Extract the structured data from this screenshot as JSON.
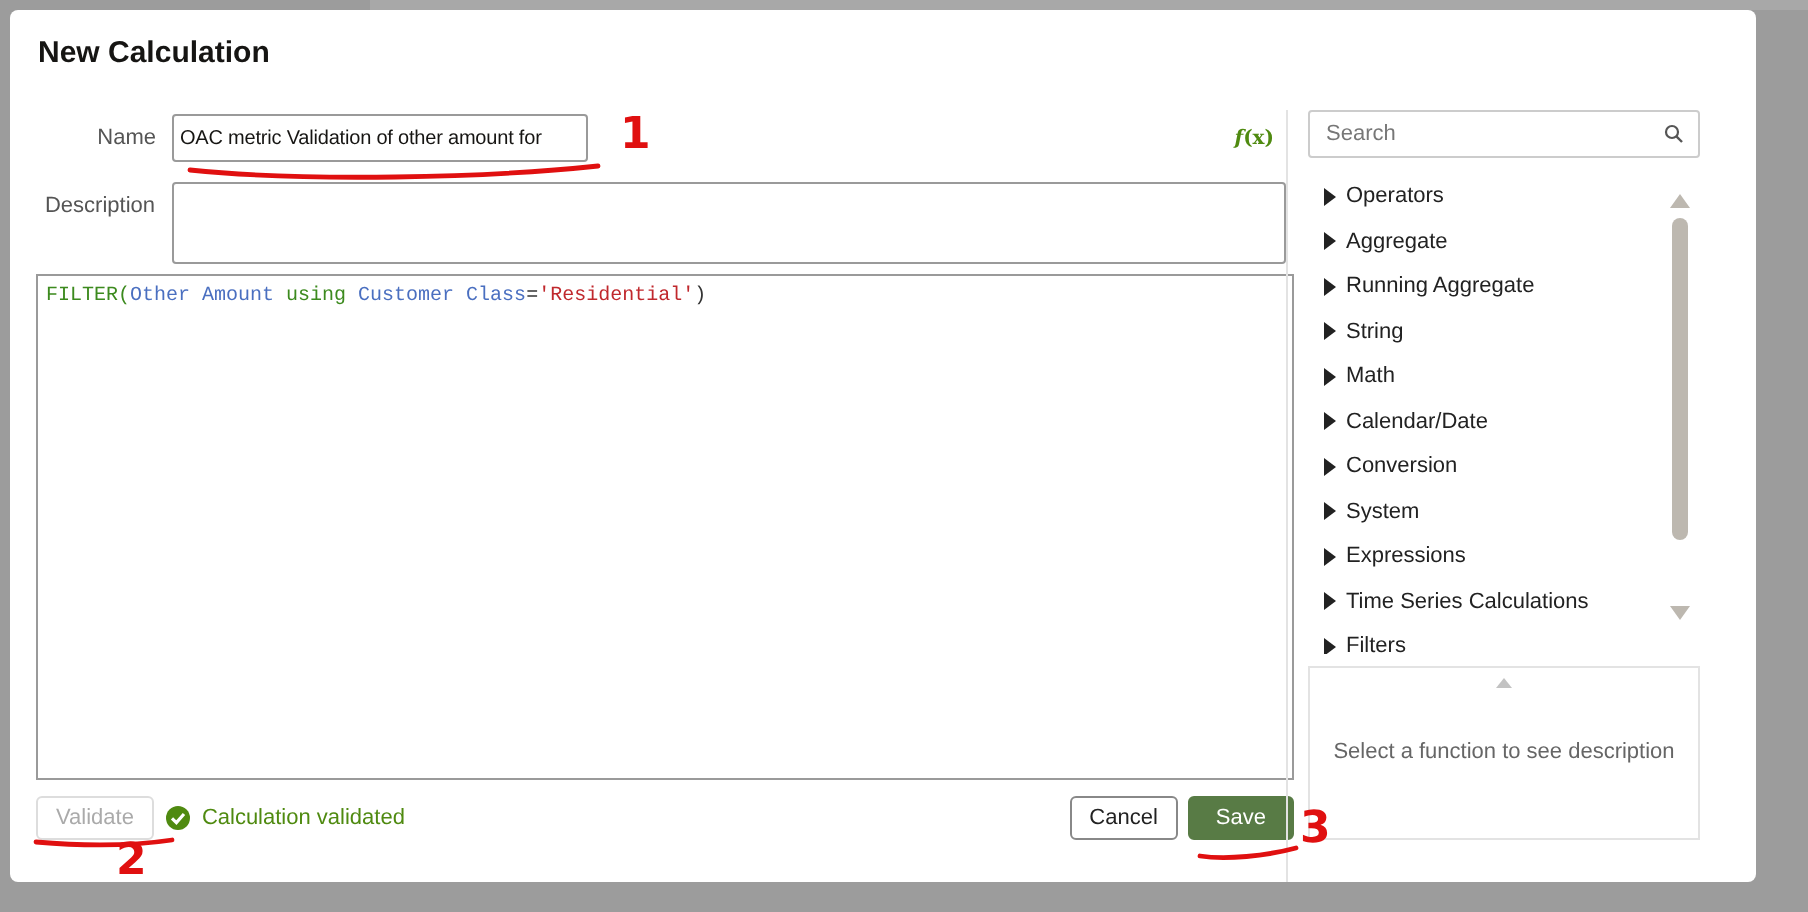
{
  "dialog": {
    "title": "New Calculation",
    "name_field": {
      "label": "Name",
      "value": "OAC metric Validation of other amount for"
    },
    "description_field": {
      "label": "Description"
    },
    "formula_button": "*f*(x)",
    "expression": [
      {
        "kind": "function",
        "text": "FILTER("
      },
      {
        "kind": "column",
        "text": "Other Amount"
      },
      {
        "kind": "function",
        "text": " using "
      },
      {
        "kind": "column",
        "text": "Customer Class"
      },
      {
        "kind": "plain",
        "text": "="
      },
      {
        "kind": "string",
        "text": "'Residential'"
      },
      {
        "kind": "plain",
        "text": ")"
      }
    ],
    "validate_button": {
      "label": "Validate",
      "disabled": true
    },
    "validation": {
      "passed": true,
      "message": "Calculation validated"
    },
    "buttons": [
      {
        "label": "Cancel",
        "kind": "secondary"
      },
      {
        "label": "Save",
        "kind": "primary"
      }
    ],
    "function_panel": {
      "search_placeholder": "Search",
      "categories": [
        {
          "label": "Operators",
          "expanded": false
        },
        {
          "label": "Aggregate",
          "expanded": false
        },
        {
          "label": "Running Aggregate",
          "expanded": false
        },
        {
          "label": "String",
          "expanded": false
        },
        {
          "label": "Math",
          "expanded": false
        },
        {
          "label": "Calendar/Date",
          "expanded": false
        },
        {
          "label": "Conversion",
          "expanded": false
        },
        {
          "label": "System",
          "expanded": false
        },
        {
          "label": "Expressions",
          "expanded": false
        },
        {
          "label": "Time Series Calculations",
          "expanded": false
        },
        {
          "label": "Filters",
          "expanded": false
        }
      ],
      "description_hint": "Select a function to see description"
    }
  },
  "annotations": [
    {
      "kind": "name",
      "text": "1"
    },
    {
      "kind": "validate",
      "text": "2"
    },
    {
      "kind": "save",
      "text": "3"
    }
  ]
}
